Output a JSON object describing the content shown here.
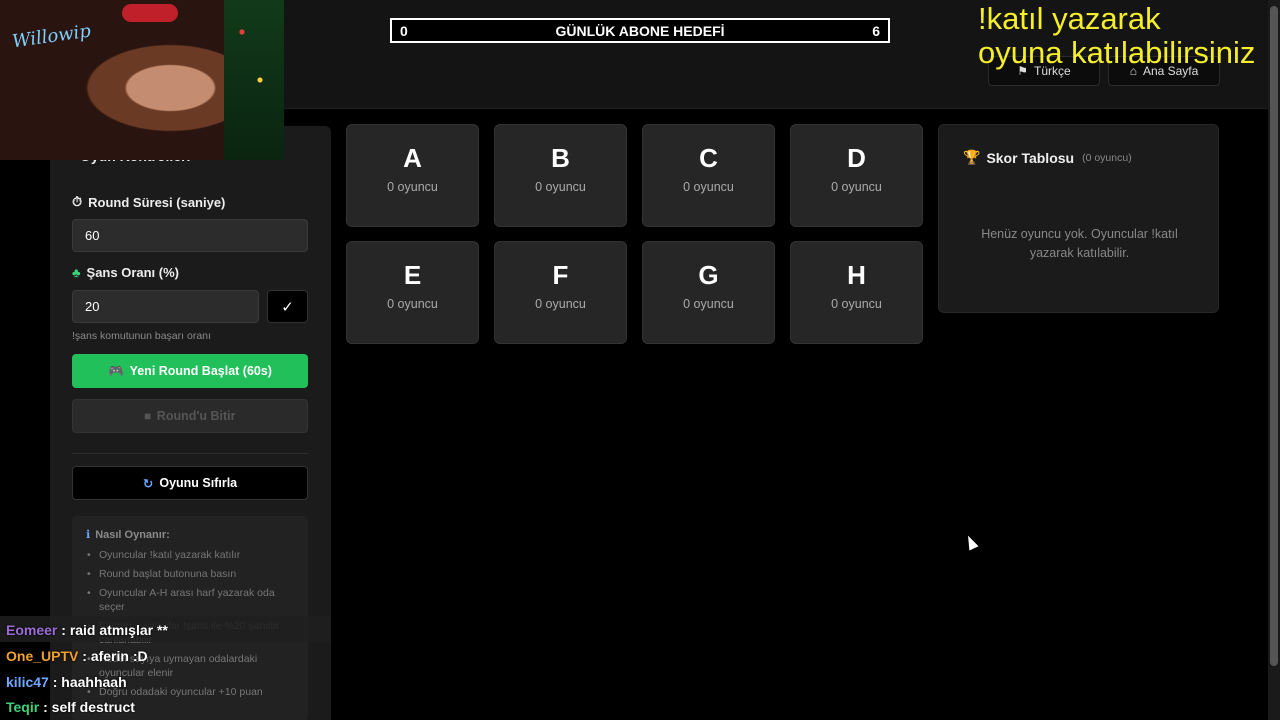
{
  "header": {
    "goal": {
      "left_value": "0",
      "title": "GÜNLÜK ABONE HEDEFİ",
      "right_value": "6"
    },
    "language_button": {
      "icon": "flag-icon",
      "label": "Türkçe"
    },
    "home_button": {
      "icon": "home-icon",
      "label": "Ana Sayfa"
    }
  },
  "overlay": {
    "line1": "!katıl yazarak",
    "line2": "oyuna katılabilirsiniz"
  },
  "webcam": {
    "logo": "Willowip"
  },
  "control_panel": {
    "title": "Oyun Kontrolleri",
    "round_duration": {
      "icon": "timer-icon",
      "label": "Round Süresi (saniye)",
      "value": "60"
    },
    "luck_rate": {
      "icon": "clover-icon",
      "label": "Şans Oranı (%)",
      "value": "20",
      "confirm": "✓",
      "hint": "!şans komutunun başarı oranı"
    },
    "start_button": {
      "icon": "gamepad-icon",
      "label": "Yeni Round Başlat (60s)"
    },
    "end_button": {
      "icon": "stop-icon",
      "label": "Round'u Bitir"
    },
    "reset_button": {
      "icon": "refresh-icon",
      "label": "Oyunu Sıfırla"
    },
    "how_to": {
      "icon": "info-icon",
      "title": "Nasıl Oynanır:",
      "items": [
        "Oyuncular !katıl yazarak katılır",
        "Round başlat butonuna basın",
        "Oyuncular A-H arası harf yazarak oda seçer",
        "Elenen oyuncular !şans ile %20 şansla canlanabilir",
        "Hedef sayıya uymayan odalardaki oyuncular elenir",
        "Doğru odadaki oyuncular +10 puan"
      ]
    }
  },
  "rooms": [
    {
      "letter": "A",
      "count": "0 oyuncu"
    },
    {
      "letter": "B",
      "count": "0 oyuncu"
    },
    {
      "letter": "C",
      "count": "0 oyuncu"
    },
    {
      "letter": "D",
      "count": "0 oyuncu"
    },
    {
      "letter": "E",
      "count": "0 oyuncu"
    },
    {
      "letter": "F",
      "count": "0 oyuncu"
    },
    {
      "letter": "G",
      "count": "0 oyuncu"
    },
    {
      "letter": "H",
      "count": "0 oyuncu"
    }
  ],
  "scoreboard": {
    "icon": "trophy-icon",
    "title": "Skor Tablosu",
    "subtitle": "(0 oyuncu)",
    "empty_text": "Henüz oyuncu yok. Oyuncular !katıl yazarak katılabilir."
  },
  "chat": [
    {
      "user": "Eomeer",
      "message": "raid atmışlar **",
      "color": "#9b6bd6"
    },
    {
      "user": "One_UPTV",
      "message": "aferin :D",
      "color": "#f0a030"
    },
    {
      "user": "kilic47",
      "message": "haahhaah",
      "color": "#6fa8ff"
    },
    {
      "user": "Teqir",
      "message": "self destruct",
      "color": "#3fd07a"
    }
  ],
  "colors": {
    "accent_green": "#22c05a",
    "overlay_yellow": "#f5ee2a",
    "background": "#000000",
    "card": "#262626"
  }
}
